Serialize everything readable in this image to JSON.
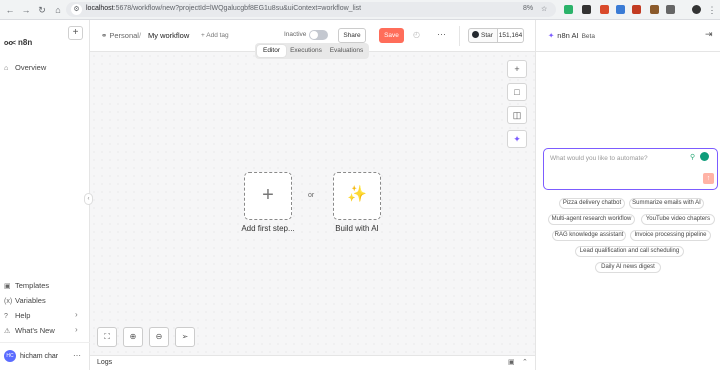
{
  "browser": {
    "url_host": "localhost",
    "url_path": ":5678/workflow/new?projectId=lWQgalucgbf8EG1u8su&uiContext=workflow_list",
    "zoom_badge": "8%",
    "star_icon": "star-icon"
  },
  "sidebar": {
    "logo_text": "n8n",
    "add_button": "+",
    "overview": "Overview",
    "bottom_items": [
      {
        "label": "Templates",
        "icon": "templates-icon"
      },
      {
        "label": "Variables",
        "icon": "variables-icon"
      },
      {
        "label": "Help",
        "icon": "help-icon"
      },
      {
        "label": "What's New",
        "icon": "bell-icon"
      }
    ],
    "user": {
      "initials": "HC",
      "name": "hicham char",
      "more": "⋯"
    }
  },
  "header": {
    "project": "Personal",
    "separator": "/",
    "workflow_name": "My workflow",
    "add_tag": "+ Add tag",
    "status_label": "Inactive",
    "share": "Share",
    "save": "Save",
    "more": "⋯",
    "github": {
      "label": "Star",
      "count": "151,164"
    }
  },
  "tabs": [
    {
      "label": "Editor",
      "active": true
    },
    {
      "label": "Executions",
      "active": false
    },
    {
      "label": "Evaluations",
      "active": false
    }
  ],
  "canvas": {
    "add_first_step": "Add first step...",
    "or": "or",
    "build_with_ai": "Build with AI",
    "right_tools": [
      "plus-icon",
      "sticky-note-icon",
      "panel-icon",
      "sparkle-icon"
    ],
    "zoom_tools": [
      "fit-view-icon",
      "zoom-in-icon",
      "zoom-out-icon",
      "pointer-icon"
    ]
  },
  "logs": {
    "label": "Logs"
  },
  "ai_panel": {
    "title": "n8n AI",
    "badge": "Beta",
    "placeholder": "What would you like to automate?",
    "suggestions": [
      "Pizza delivery chatbot",
      "Summarize emails with AI",
      "Multi-agent research workflow",
      "YouTube video chapters",
      "RAG knowledge assistant",
      "Invoice processing pipeline",
      "Lead qualification and call scheduling",
      "Daily AI news digest"
    ]
  },
  "colors": {
    "save": "#ff6d5a",
    "ai_accent": "#7c5cff",
    "canvas_bg": "#f6f6f7"
  }
}
